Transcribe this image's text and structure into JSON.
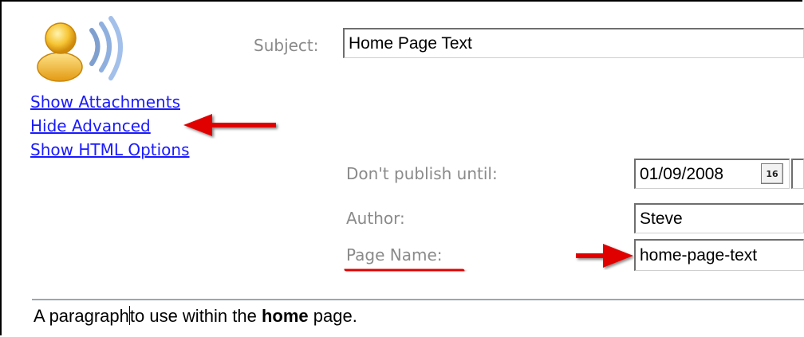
{
  "links": {
    "show_attachments": "Show Attachments",
    "hide_advanced": "Hide Advanced",
    "show_html_options": "Show HTML Options"
  },
  "form": {
    "subject_label": "Subject:",
    "subject_value": "Home Page Text",
    "publish_label": "Don't publish until:",
    "publish_value": "01/09/2008",
    "calendar_day": "16",
    "author_label": "Author:",
    "author_value": "Steve",
    "page_name_label": "Page Name:",
    "page_name_value": "home-page-text"
  },
  "editor": {
    "before_caret": "A paragraph",
    "after_caret": "to use within the ",
    "bold_word": "home",
    "tail": " page."
  },
  "colors": {
    "link": "#1a1aff",
    "annotation_red": "#e00000",
    "label_gray": "#8a8a8a"
  },
  "icons": [
    "contact-avatar-icon",
    "calendar-icon",
    "annotation-arrow-icon"
  ]
}
